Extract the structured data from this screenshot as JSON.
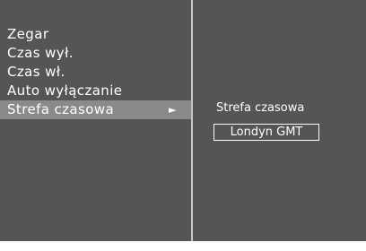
{
  "menu": {
    "items": [
      {
        "label": "Zegar"
      },
      {
        "label": "Czas wył."
      },
      {
        "label": "Czas wł."
      },
      {
        "label": "Auto wyłączanie"
      },
      {
        "label": "Strefa czasowa"
      }
    ],
    "selected_index": 4,
    "submenu_arrow": "►"
  },
  "submenu": {
    "label": "Strefa czasowa",
    "value": "Londyn GMT"
  }
}
